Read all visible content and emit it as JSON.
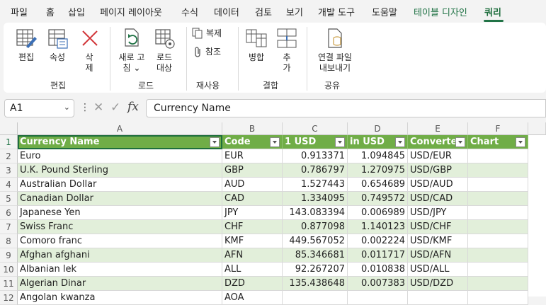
{
  "menu": {
    "items": [
      "파일",
      "홈",
      "삽입",
      "페이지 레이아웃",
      "수식",
      "데이터",
      "검토",
      "보기",
      "개발 도구",
      "도움말",
      "테이블 디자인",
      "쿼리"
    ]
  },
  "ribbon": {
    "edit": {
      "edit_label": "편집",
      "props_label": "속성",
      "delete_label_1": "삭",
      "delete_label_2": "제",
      "group": "편집"
    },
    "load": {
      "refresh_label_1": "새로 고",
      "refresh_label_2": "침 ⌄",
      "reload_label_1": "로드",
      "reload_label_2": "대상",
      "group": "로드"
    },
    "reuse": {
      "duplicate_label": "복제",
      "reference_label": "참조",
      "group": "재사용"
    },
    "combine": {
      "merge_label": "병합",
      "append_label_1": "추",
      "append_label_2": "가",
      "group": "결합"
    },
    "share": {
      "export_label_1": "연결 파일",
      "export_label_2": "내보내기",
      "group": "공유"
    }
  },
  "formula_bar": {
    "name_box": "A1",
    "formula": "Currency Name",
    "fx": "fx"
  },
  "sheet": {
    "columns": [
      "A",
      "B",
      "C",
      "D",
      "E",
      "F"
    ],
    "header_row": [
      "Currency Name",
      "Code",
      "1 USD",
      "in USD",
      "Converter",
      "Chart"
    ],
    "row_numbers": [
      "1",
      "2",
      "3",
      "4",
      "5",
      "6",
      "7",
      "8",
      "9",
      "10",
      "11",
      "12"
    ],
    "rows": [
      [
        "Euro",
        "EUR",
        "0.913371",
        "1.094845",
        "USD/EUR",
        ""
      ],
      [
        "U.K. Pound Sterling",
        "GBP",
        "0.786797",
        "1.270975",
        "USD/GBP",
        ""
      ],
      [
        "Australian Dollar",
        "AUD",
        "1.527443",
        "0.654689",
        "USD/AUD",
        ""
      ],
      [
        "Canadian Dollar",
        "CAD",
        "1.334095",
        "0.749572",
        "USD/CAD",
        ""
      ],
      [
        "Japanese Yen",
        "JPY",
        "143.083394",
        "0.006989",
        "USD/JPY",
        ""
      ],
      [
        "Swiss Franc",
        "CHF",
        "0.877098",
        "1.140123",
        "USD/CHF",
        ""
      ],
      [
        "Comoro franc",
        "KMF",
        "449.567052",
        "0.002224",
        "USD/KMF",
        ""
      ],
      [
        "Afghan afghani",
        "AFN",
        "85.346681",
        "0.011717",
        "USD/AFN",
        ""
      ],
      [
        "Albanian lek",
        "ALL",
        "92.267207",
        "0.010838",
        "USD/ALL",
        ""
      ],
      [
        "Algerian Dinar",
        "DZD",
        "135.438648",
        "0.007383",
        "USD/DZD",
        ""
      ],
      [
        "Angolan kwanza",
        "AOA",
        "",
        "",
        "",
        ""
      ]
    ]
  },
  "colors": {
    "accent": "#217346",
    "table_header": "#70ad47",
    "band": "#e2efda"
  }
}
